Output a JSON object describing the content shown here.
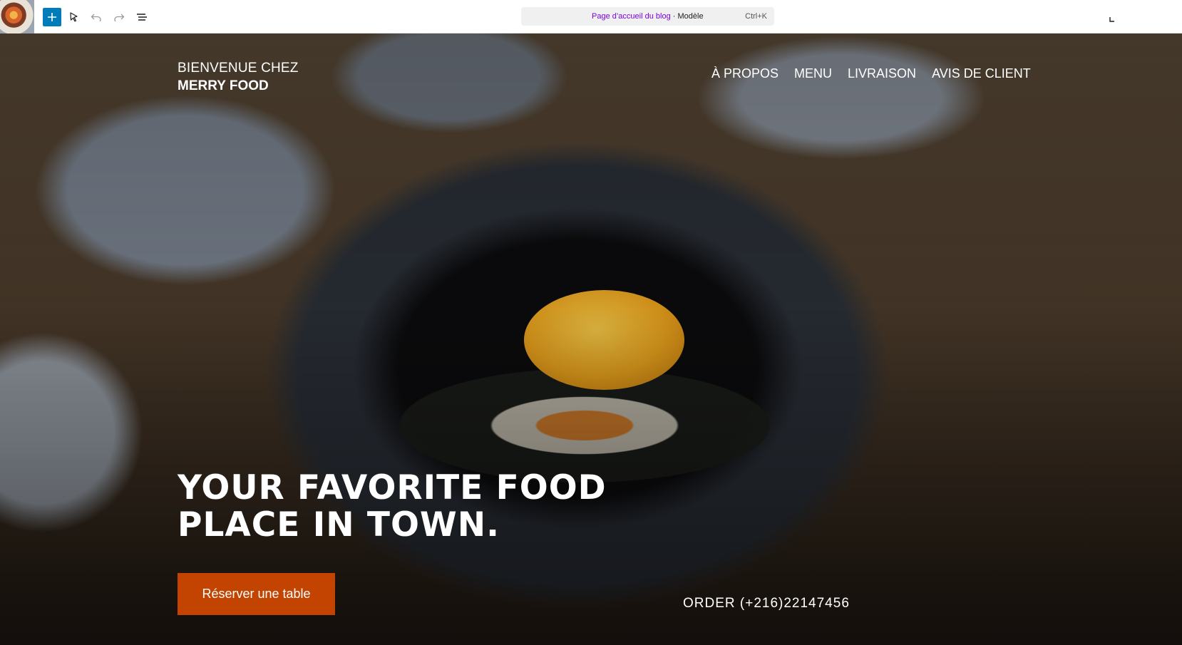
{
  "editor": {
    "document_title": "Page d’accueil du blog",
    "separator": " · ",
    "template_label": "Modèle",
    "shortcut": "Ctrl+K",
    "accent_color": "#007cba"
  },
  "site": {
    "brand_line1": "BIENVENUE CHEZ",
    "brand_line2": "MERRY FOOD",
    "nav": [
      "À PROPOS",
      "MENU",
      "LIVRAISON",
      "AVIS DE CLIENT"
    ],
    "headline": "YOUR FAVORITE FOOD PLACE IN TOWN.",
    "cta_label": "Réserver une table",
    "cta_color": "#c24400",
    "order_text": "ORDER (+216)22147456"
  }
}
